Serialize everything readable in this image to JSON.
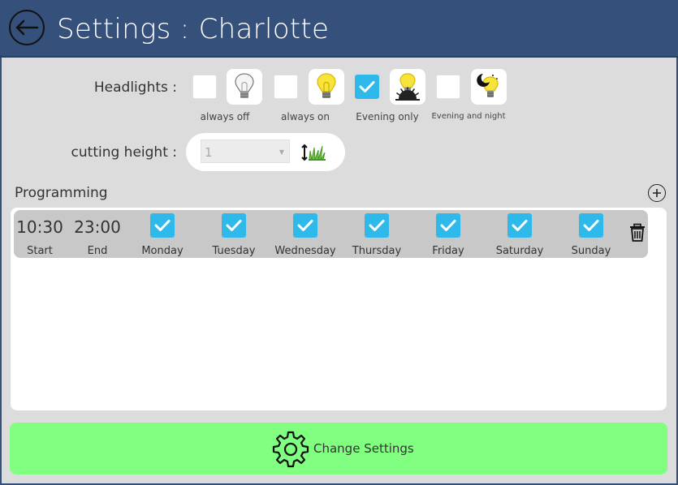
{
  "header": {
    "title": "Settings : Charlotte"
  },
  "headlights": {
    "label": "Headlights :",
    "options": [
      {
        "caption": "always off",
        "checked": false,
        "icon": "bulb-off-icon"
      },
      {
        "caption": "always on",
        "checked": false,
        "icon": "bulb-on-icon"
      },
      {
        "caption": "Evening only",
        "checked": true,
        "icon": "bulb-sunset-icon"
      },
      {
        "caption": "Evening and night",
        "checked": false,
        "icon": "bulb-moon-icon"
      }
    ]
  },
  "cutting_height": {
    "label": "cutting height :",
    "value": "1",
    "icon": "grass-height-icon"
  },
  "programming": {
    "label": "Programming",
    "rows": [
      {
        "start": "10:30",
        "start_label": "Start",
        "end": "23:00",
        "end_label": "End",
        "days": [
          {
            "label": "Monday",
            "checked": true
          },
          {
            "label": "Tuesday",
            "checked": true
          },
          {
            "label": "Wednesday",
            "checked": true
          },
          {
            "label": "Thursday",
            "checked": true
          },
          {
            "label": "Friday",
            "checked": true
          },
          {
            "label": "Saturday",
            "checked": true
          },
          {
            "label": "Sunday",
            "checked": true
          }
        ]
      }
    ]
  },
  "change_button": {
    "label": "Change Settings"
  },
  "colors": {
    "header": "#35507a",
    "checkbox_on": "#2fb8ea",
    "change_button": "#80ff80",
    "background": "#dcdcdc"
  }
}
